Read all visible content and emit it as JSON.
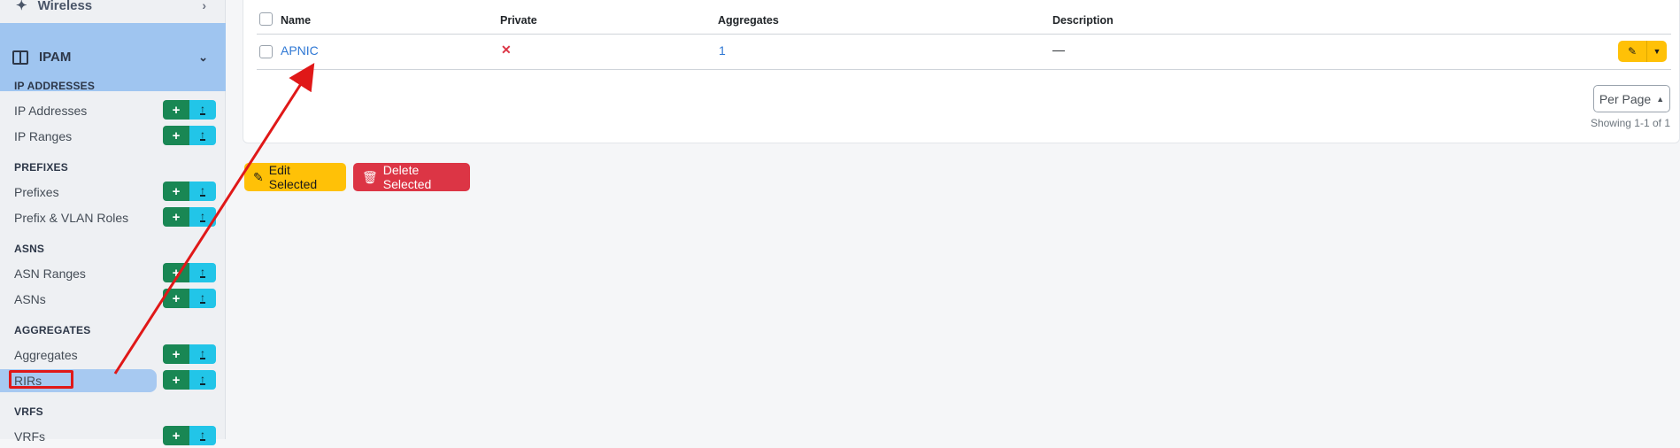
{
  "sidebar": {
    "top_item": "Wireless",
    "section": "IPAM",
    "groups": [
      {
        "label": "IP ADDRESSES",
        "items": [
          "IP Addresses",
          "IP Ranges"
        ]
      },
      {
        "label": "PREFIXES",
        "items": [
          "Prefixes",
          "Prefix & VLAN Roles"
        ]
      },
      {
        "label": "ASNS",
        "items": [
          "ASN Ranges",
          "ASNs"
        ]
      },
      {
        "label": "AGGREGATES",
        "items": [
          "Aggregates",
          "RIRs"
        ]
      },
      {
        "label": "VRFS",
        "items": [
          "VRFs"
        ]
      }
    ],
    "add_icon": "plus-icon",
    "import_icon": "upload-icon"
  },
  "table": {
    "columns": [
      "Name",
      "Private",
      "Aggregates",
      "Description"
    ],
    "rows": [
      {
        "name": "APNIC",
        "private": "✕",
        "aggregates": "1",
        "description": "—"
      }
    ]
  },
  "pagination": {
    "per_page_label": "Per Page",
    "showing": "Showing 1-1 of 1"
  },
  "actions": {
    "edit_selected": "Edit Selected",
    "delete_selected": "Delete Selected"
  },
  "colors": {
    "accent": "#9fc5f0",
    "success": "#198754",
    "info": "#22c5e8",
    "warning": "#ffc107",
    "danger": "#dc3545",
    "annotation": "#e01818"
  }
}
